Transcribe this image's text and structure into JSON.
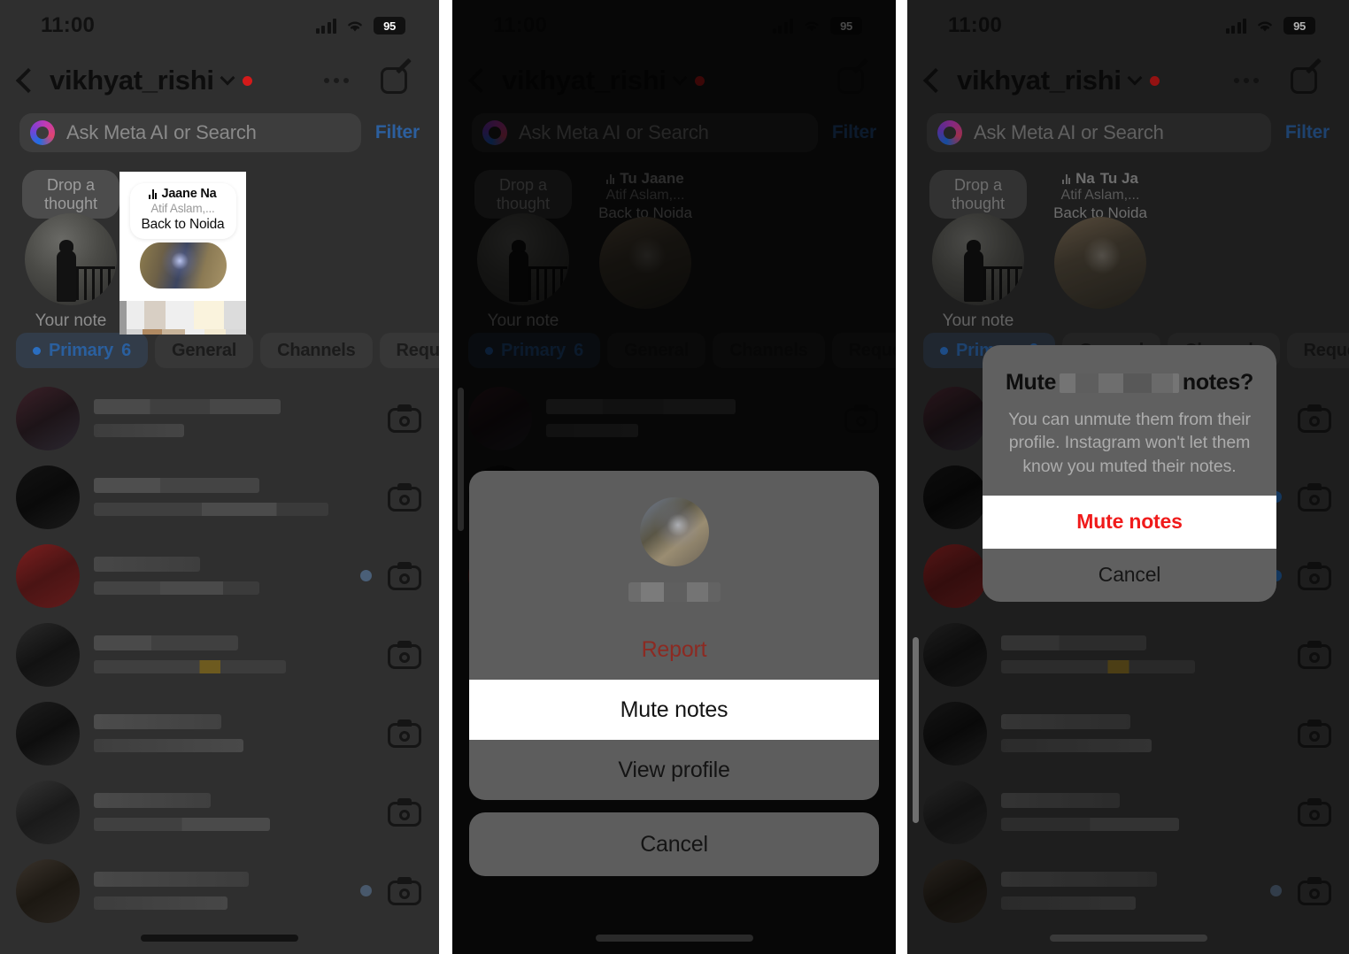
{
  "statusbar": {
    "time": "11:00",
    "battery": "95",
    "signal_icon": "cellular-bars-icon",
    "wifi_icon": "wifi-icon",
    "battery_icon": "battery-icon"
  },
  "header": {
    "back_icon": "back-chevron-icon",
    "username": "vikhyat_rishi",
    "dropdown_icon": "chevron-down-icon",
    "unread_badge_color": "#d41a1a",
    "more_icon": "more-options-icon",
    "compose_icon": "compose-icon"
  },
  "search": {
    "icon": "meta-ai-icon",
    "placeholder": "Ask Meta AI or Search",
    "filter_label": "Filter",
    "filter_color": "#2c5f9e"
  },
  "notes": {
    "your_note": {
      "bubble_text": "Drop a thought",
      "label": "Your note",
      "avatar_icon": "user-avatar-photo"
    },
    "note_card": {
      "music_icon": "audio-waveform-icon",
      "song_title": "Jaane Na",
      "artist": "Atif Aslam,...",
      "caption": "Back to Noida"
    },
    "friend_note_panel2": {
      "music_icon": "audio-waveform-icon",
      "song_title": "Tu Jaane",
      "artist": "Atif Aslam,...",
      "caption": "Back to Noida"
    },
    "friend_note_panel3": {
      "music_icon": "audio-waveform-icon",
      "song_title_back": "Na",
      "song_title_front": "Tu Ja",
      "artist": "Atif Aslam,...",
      "caption": "Back to Noida"
    }
  },
  "tabs": [
    {
      "label": "Primary",
      "count": "6",
      "active": true,
      "dot_color": "#2a6ec0"
    },
    {
      "label": "General",
      "count": "",
      "active": false
    },
    {
      "label": "Channels",
      "count": "",
      "active": false
    },
    {
      "label": "Requests",
      "count": "",
      "active": false
    }
  ],
  "conversation_rows": [
    {
      "redacted": true,
      "has_unread_dot": false,
      "camera_icon": "camera-icon"
    },
    {
      "redacted": true,
      "has_unread_dot": false,
      "camera_icon": "camera-icon"
    },
    {
      "redacted": true,
      "has_unread_dot": true,
      "camera_icon": "camera-icon"
    },
    {
      "redacted": true,
      "has_unread_dot": false,
      "camera_icon": "camera-icon"
    },
    {
      "redacted": true,
      "has_unread_dot": true,
      "camera_icon": "camera-icon"
    },
    {
      "redacted": true,
      "has_unread_dot": false,
      "camera_icon": "camera-icon"
    },
    {
      "redacted": true,
      "has_unread_dot": false,
      "camera_icon": "camera-icon"
    }
  ],
  "action_sheet": {
    "avatar_icon": "contact-avatar",
    "name_redacted": true,
    "items": [
      {
        "label": "Report",
        "style": "destructive"
      },
      {
        "label": "Mute notes",
        "style": "highlight"
      },
      {
        "label": "View profile",
        "style": "normal"
      }
    ],
    "cancel_label": "Cancel"
  },
  "mute_alert": {
    "title_prefix": "Mute",
    "title_suffix": "notes?",
    "message": "You can unmute them from their profile. Instagram won't let them know you muted their notes.",
    "confirm_label": "Mute notes",
    "confirm_color": "#f01b1b",
    "cancel_label": "Cancel"
  }
}
